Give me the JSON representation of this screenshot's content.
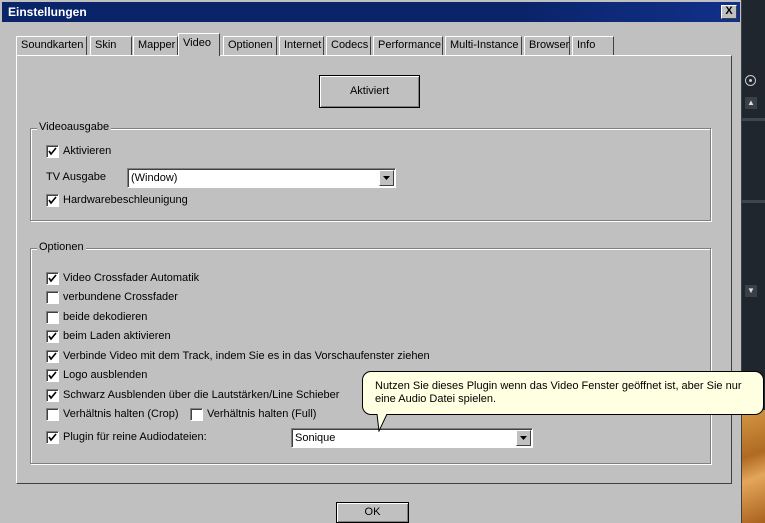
{
  "window": {
    "title": "Einstellungen",
    "close_label": "X"
  },
  "tabs": [
    {
      "label": "Soundkarten"
    },
    {
      "label": "Skin"
    },
    {
      "label": "Mapper"
    },
    {
      "label": "Video",
      "active": true
    },
    {
      "label": "Optionen"
    },
    {
      "label": "Internet"
    },
    {
      "label": "Codecs"
    },
    {
      "label": "Performance"
    },
    {
      "label": "Multi-Instance"
    },
    {
      "label": "Browser"
    },
    {
      "label": "Info"
    }
  ],
  "activate_button": "Aktiviert",
  "video_output": {
    "title": "Videoausgabe",
    "enable": {
      "label": "Aktivieren",
      "checked": true
    },
    "tv_label": "TV Ausgabe",
    "tv_value": "(Window)",
    "hw_accel": {
      "label": "Hardwarebeschleunigung",
      "checked": true
    }
  },
  "options": {
    "title": "Optionen",
    "items": [
      {
        "label": "Video Crossfader Automatik",
        "checked": true
      },
      {
        "label": "verbundene Crossfader",
        "checked": false
      },
      {
        "label": "beide dekodieren",
        "checked": false
      },
      {
        "label": "beim Laden aktivieren",
        "checked": true
      },
      {
        "label": "Verbinde Video mit dem Track, indem Sie es in das Vorschaufenster ziehen",
        "checked": true
      },
      {
        "label": "Logo ausblenden",
        "checked": true
      },
      {
        "label": "Schwarz Ausblenden über die Lautstärken/Line Schieber",
        "checked": true
      },
      {
        "label": "Verhältnis halten (Crop)",
        "checked": false
      },
      {
        "label": "Verhältnis halten (Full)",
        "checked": false
      },
      {
        "label": "Plugin für reine Audiodateien:",
        "checked": true
      }
    ],
    "plugin_value": "Sonique"
  },
  "tooltip": "Nutzen Sie dieses Plugin wenn das Video Fenster geöffnet ist, aber Sie nur eine Audio Datei spielen.",
  "ok_button": "OK",
  "colors": {
    "titlebar": "#0a246a",
    "face": "#c0c0c0",
    "tooltip_bg": "#ffffe1"
  }
}
